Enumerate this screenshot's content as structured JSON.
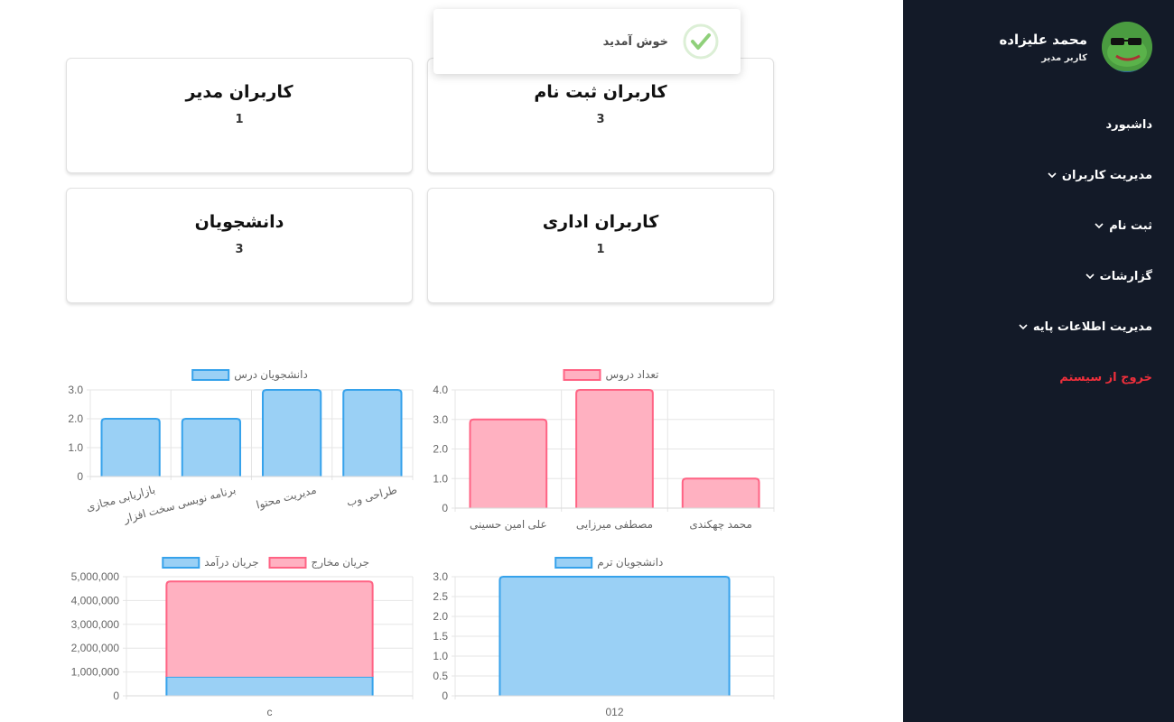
{
  "toast": {
    "message": "خوش آمدید"
  },
  "sidebar": {
    "user_name": "محمد علیزاده",
    "user_role": "کاربر مدیر",
    "items": [
      {
        "label": "داشبورد",
        "has_submenu": false
      },
      {
        "label": "مدیریت کاربران",
        "has_submenu": true
      },
      {
        "label": "ثبت نام",
        "has_submenu": true
      },
      {
        "label": "گزارشات",
        "has_submenu": true
      },
      {
        "label": "مدیریت اطلاعات پایه",
        "has_submenu": true
      },
      {
        "label": "خروج از سیستم",
        "has_submenu": false
      }
    ]
  },
  "cards": [
    {
      "title": "کاربران ثبت نام",
      "value": "3"
    },
    {
      "title": "کاربران مدیر",
      "value": "1"
    },
    {
      "title": "کاربران اداری",
      "value": "1"
    },
    {
      "title": "دانشجویان",
      "value": "3"
    }
  ],
  "colors": {
    "blue": "#9ad0f5",
    "blue_border": "#36a2eb",
    "pink": "#ffb1c1",
    "pink_border": "#ff6384",
    "sidebar": "#131a28",
    "logout": "#ef2f3b"
  },
  "chart_data": [
    {
      "type": "bar",
      "categories": [
        "علی امین حسینی",
        "مصطفی میرزایی",
        "محمد چهکندی"
      ],
      "series": [
        {
          "name": "تعداد دروس",
          "values": [
            3,
            4,
            1
          ]
        }
      ],
      "ylim": [
        0,
        4
      ]
    },
    {
      "type": "bar",
      "categories": [
        "بازاریابی مجازی",
        "برنامه نویسی سخت افزار",
        "مدیریت محتوا",
        "طراحی وب"
      ],
      "series": [
        {
          "name": "دانشجویان درس",
          "values": [
            2,
            2,
            3,
            3
          ]
        }
      ],
      "ylim": [
        0,
        3
      ]
    },
    {
      "type": "bar",
      "categories": [
        "012"
      ],
      "series": [
        {
          "name": "دانشجویان ترم",
          "values": [
            3
          ]
        }
      ],
      "ylim": [
        0,
        3
      ]
    },
    {
      "type": "bar",
      "stacked": true,
      "categories": [
        "c"
      ],
      "series": [
        {
          "name": "جریان درآمد",
          "values": [
            800000
          ]
        },
        {
          "name": "جریان مخارج",
          "values": [
            4000000
          ]
        }
      ],
      "ylim": [
        0,
        5000000
      ]
    }
  ]
}
